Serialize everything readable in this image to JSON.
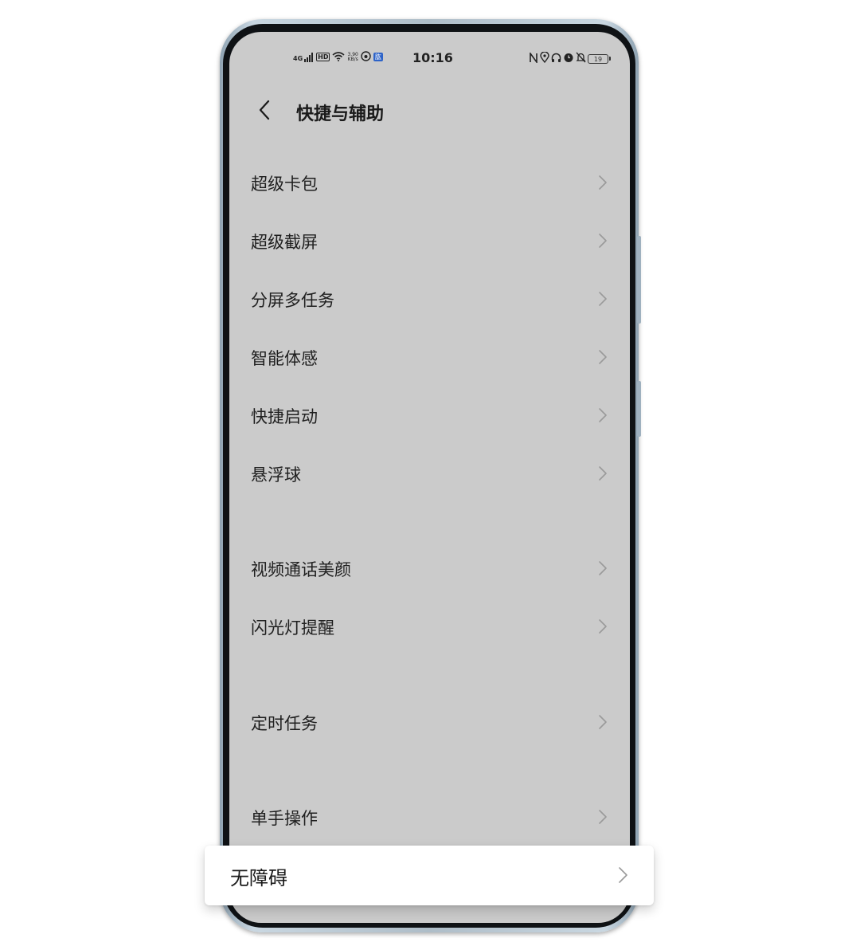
{
  "status_bar": {
    "network": "4G",
    "hd": "HD",
    "speed_value": "3.90",
    "speed_unit": "KB/s",
    "app_badge": "肱",
    "time": "10:16",
    "battery": "19"
  },
  "header": {
    "back_icon": "chevron-left-icon",
    "title": "快捷与辅助"
  },
  "menu": {
    "items": [
      {
        "label": "超级卡包"
      },
      {
        "label": "超级截屏"
      },
      {
        "label": "分屏多任务"
      },
      {
        "label": "智能体感"
      },
      {
        "label": "快捷启动"
      },
      {
        "label": "悬浮球"
      },
      {
        "label": "视频通话美颜"
      },
      {
        "label": "闪光灯提醒"
      },
      {
        "label": "定时任务"
      },
      {
        "label": "单手操作"
      }
    ],
    "highlighted": {
      "label": "无障碍"
    }
  },
  "colors": {
    "screen_background": "#cbcbcb",
    "highlight_background": "#ffffff",
    "chevron": "#9a9a9a",
    "frame": "#aebdc8"
  }
}
